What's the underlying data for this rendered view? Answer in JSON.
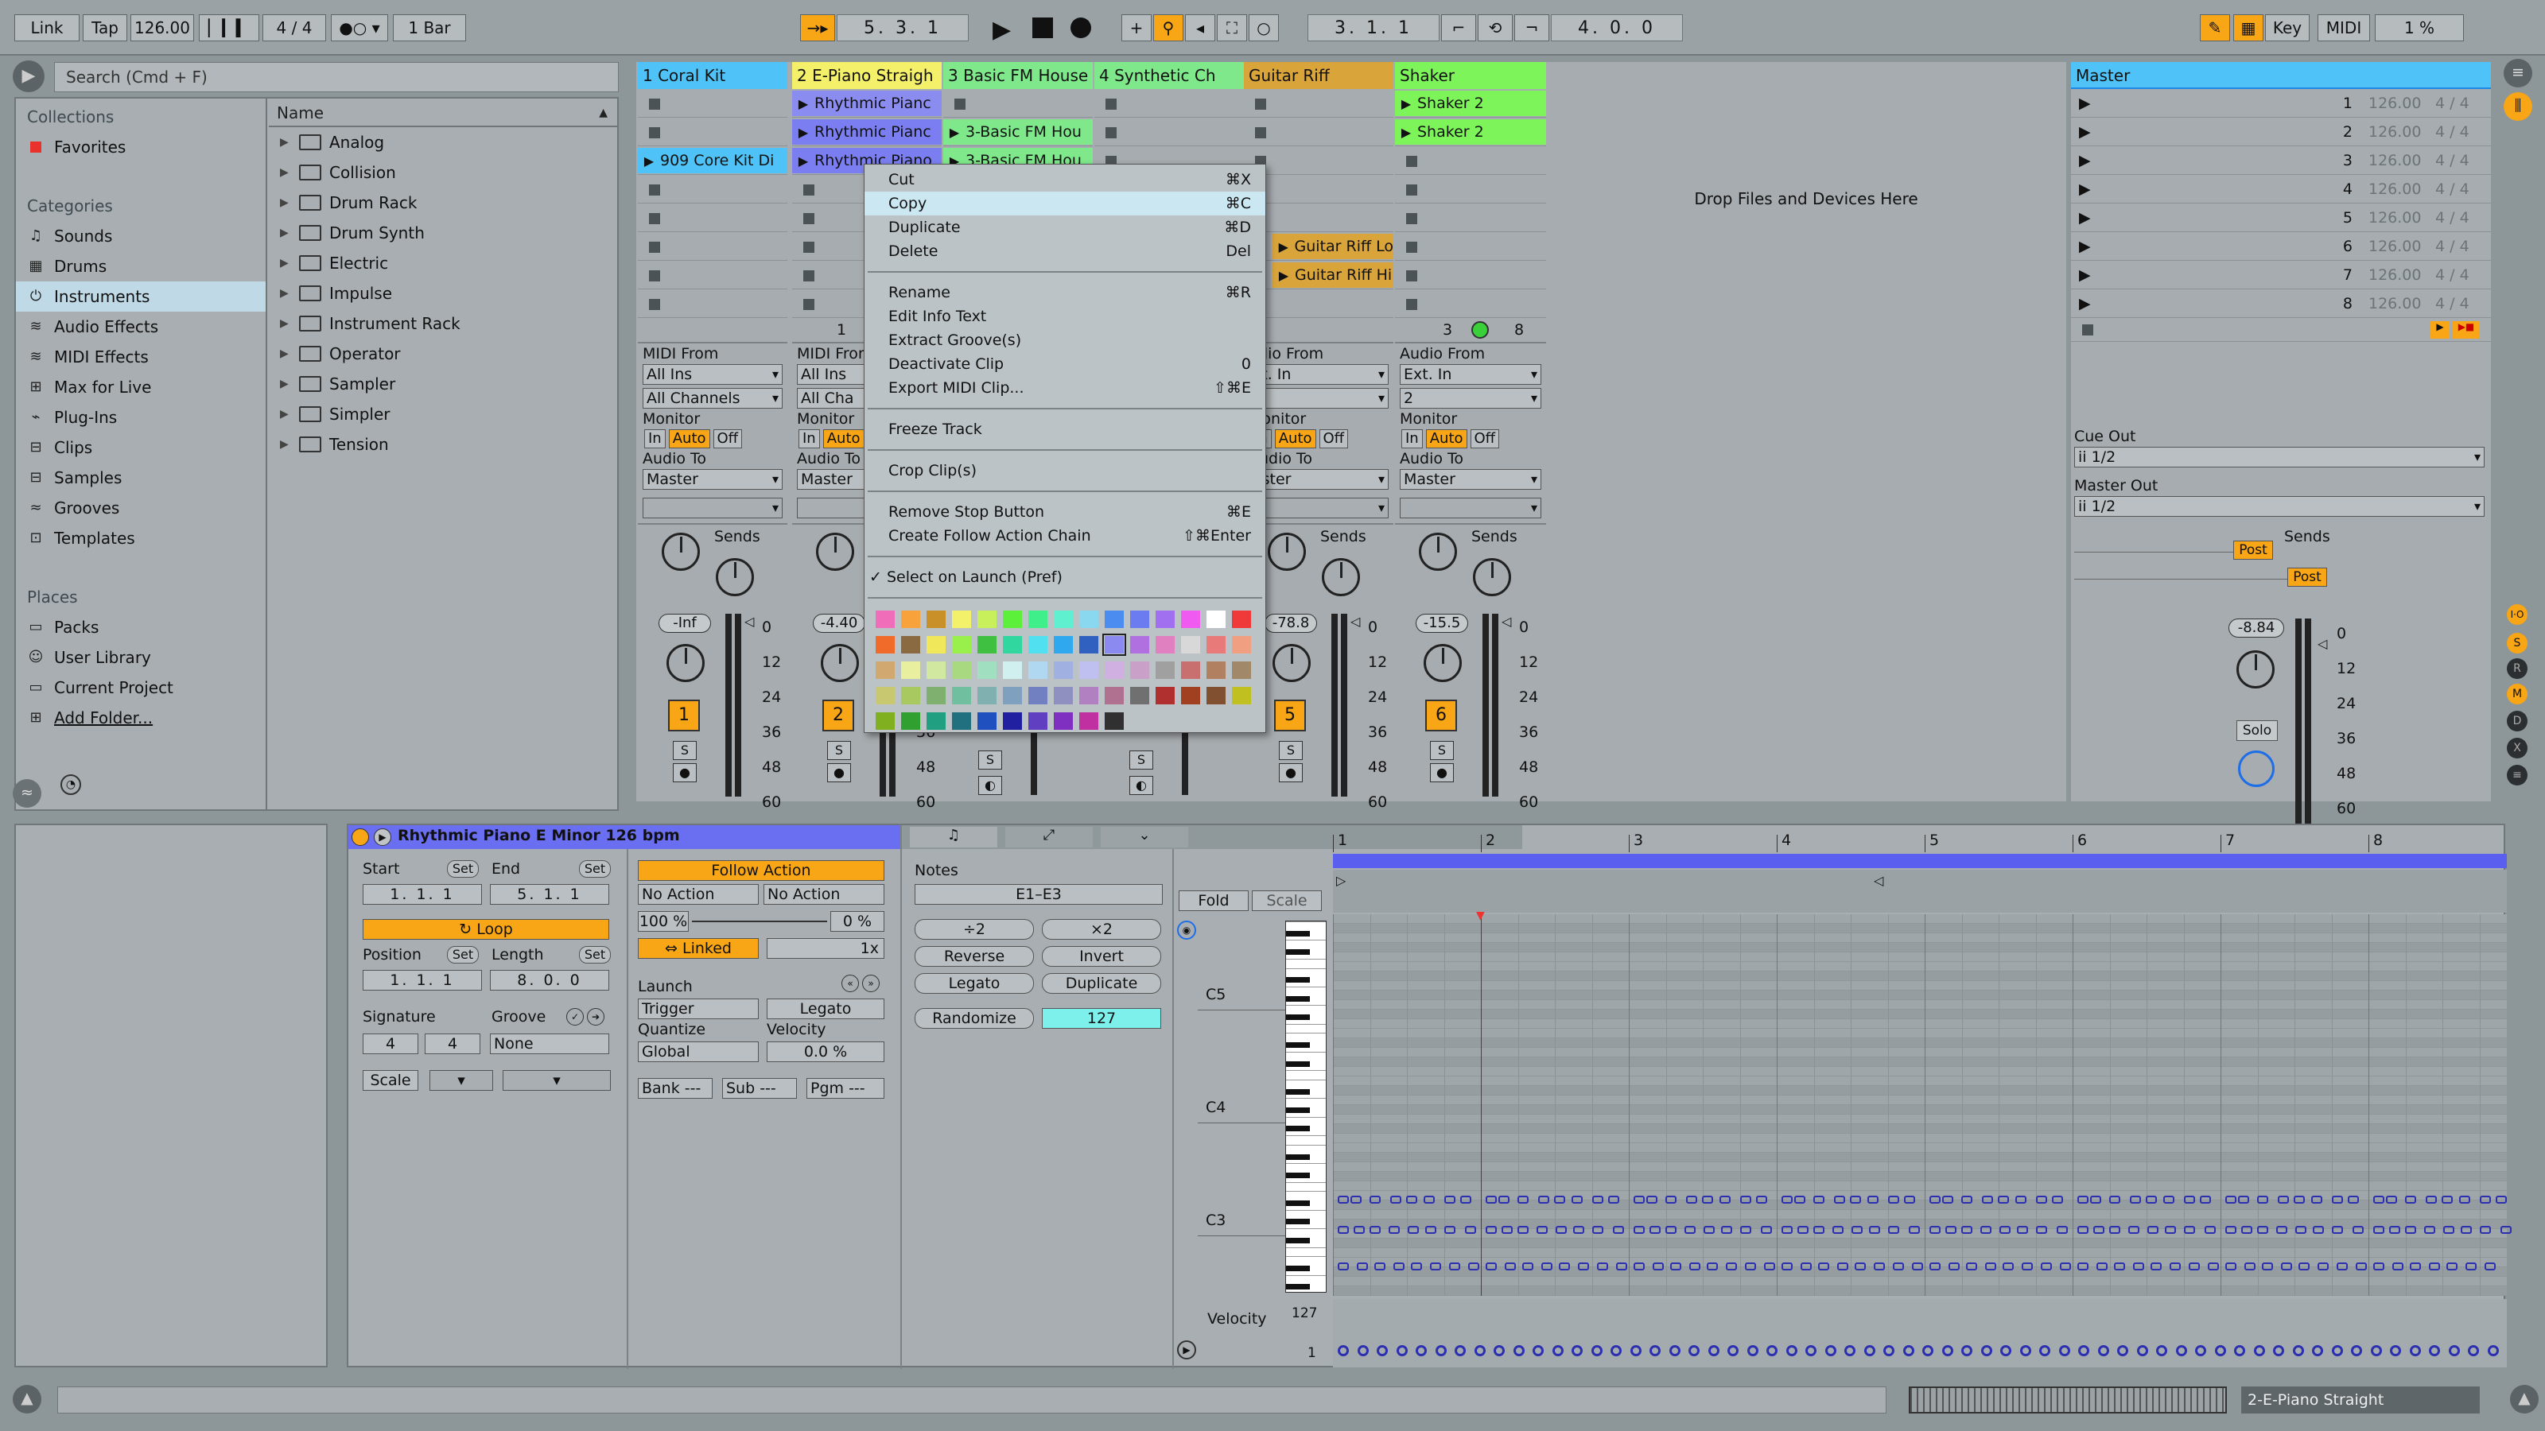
{
  "transport": {
    "link": "Link",
    "tap": "Tap",
    "tempo": "126.00",
    "signature": "4 / 4",
    "quantize": "1 Bar",
    "position": "5. 3. 1",
    "loop_start": "3. 1. 1",
    "loop_length": "4. 0. 0",
    "key": "Key",
    "midi": "MIDI",
    "cpu": "1 %"
  },
  "browser": {
    "search_placeholder": "Search (Cmd + F)",
    "collections_label": "Collections",
    "favorites": "Favorites",
    "categories_label": "Categories",
    "categories": [
      "Sounds",
      "Drums",
      "Instruments",
      "Audio Effects",
      "MIDI Effects",
      "Max for Live",
      "Plug-Ins",
      "Clips",
      "Samples",
      "Grooves",
      "Templates"
    ],
    "places_label": "Places",
    "places": [
      "Packs",
      "User Library",
      "Current Project",
      "Add Folder..."
    ],
    "name_header": "Name",
    "items": [
      "Analog",
      "Collision",
      "Drum Rack",
      "Drum Synth",
      "Electric",
      "Impulse",
      "Instrument Rack",
      "Operator",
      "Sampler",
      "Simpler",
      "Tension"
    ]
  },
  "tracks": [
    {
      "name": "1 Coral Kit",
      "color": "#4fc3f7",
      "clips": [
        "",
        "",
        "909 Core Kit Di"
      ],
      "io_from": "MIDI From",
      "in1": "All Ins",
      "in2": "All Channels",
      "to": "Master",
      "vol": "-Inf",
      "num": "1"
    },
    {
      "name": "2 E-Piano Straigh",
      "color": "#f4f06a",
      "clips": [
        "Rhythmic Pianc",
        "Rhythmic Pianc",
        "Rhythmic Piano"
      ],
      "io_from": "MIDI From",
      "in1": "All Ins",
      "in2": "All Cha",
      "to": "Master",
      "vol": "-4.40",
      "num": "2"
    },
    {
      "name": "3 Basic FM House",
      "color": "#7ee88a",
      "clips": [
        "",
        "3-Basic FM Hou",
        "3-Basic FM Hou"
      ],
      "io_from": "",
      "in1": "",
      "in2": "",
      "to": "",
      "vol": "",
      "num": ""
    },
    {
      "name": "4 Synthetic Ch",
      "color": "#7ee88a",
      "clips": [
        "",
        "",
        ""
      ],
      "io_from": "",
      "in1": "",
      "in2": "",
      "to": "",
      "vol": "",
      "num": ""
    },
    {
      "name": "Guitar Riff",
      "color": "#d9a43a",
      "clips": [
        "",
        "",
        "",
        "",
        "",
        "Guitar Riff Lo",
        "Guitar Riff Hi"
      ],
      "io_from": "udio From",
      "in1": "xt. In",
      "in2": "1",
      "to": "aster",
      "vol": "-78.8",
      "num": "5"
    },
    {
      "name": "Shaker",
      "color": "#7df55a",
      "clips": [
        "Shaker 2",
        "Shaker 2"
      ],
      "io_from": "Audio From",
      "in1": "Ext. In",
      "in2": "2",
      "to": "Master",
      "vol": "-15.5",
      "num": "6"
    }
  ],
  "session": {
    "drop_hint": "Drop Files and Devices Here",
    "sends": "Sends",
    "monitor": "Monitor",
    "audio_to": "Audio To",
    "in": "In",
    "auto": "Auto",
    "off": "Off",
    "s": "S",
    "track_num_3": "3",
    "track_num_8": "8",
    "track2_one": "1"
  },
  "master": {
    "name": "Master",
    "scenes": [
      {
        "n": "1",
        "bpm": "126.00",
        "sig": "4 / 4"
      },
      {
        "n": "2",
        "bpm": "126.00",
        "sig": "4 / 4"
      },
      {
        "n": "3",
        "bpm": "126.00",
        "sig": "4 / 4"
      },
      {
        "n": "4",
        "bpm": "126.00",
        "sig": "4 / 4"
      },
      {
        "n": "5",
        "bpm": "126.00",
        "sig": "4 / 4"
      },
      {
        "n": "6",
        "bpm": "126.00",
        "sig": "4 / 4"
      },
      {
        "n": "7",
        "bpm": "126.00",
        "sig": "4 / 4"
      },
      {
        "n": "8",
        "bpm": "126.00",
        "sig": "4 / 4"
      }
    ],
    "cue_out": "Cue Out",
    "cue_val": "ii 1/2",
    "master_out": "Master Out",
    "master_val": "ii 1/2",
    "post": "Post",
    "vol": "-8.84",
    "solo": "Solo"
  },
  "meter_scale": [
    "0",
    "12",
    "24",
    "36",
    "48",
    "60"
  ],
  "context_menu": {
    "groups": [
      [
        {
          "label": "Cut",
          "key": "⌘X"
        },
        {
          "label": "Copy",
          "key": "⌘C"
        },
        {
          "label": "Duplicate",
          "key": "⌘D"
        },
        {
          "label": "Delete",
          "key": "Del"
        }
      ],
      [
        {
          "label": "Rename",
          "key": "⌘R"
        },
        {
          "label": "Edit Info Text",
          "key": ""
        },
        {
          "label": "Extract Groove(s)",
          "key": ""
        },
        {
          "label": "Deactivate Clip",
          "key": "0"
        },
        {
          "label": "Export MIDI Clip...",
          "key": "⇧⌘E"
        }
      ],
      [
        {
          "label": "Freeze Track",
          "key": ""
        }
      ],
      [
        {
          "label": "Crop Clip(s)",
          "key": ""
        }
      ],
      [
        {
          "label": "Remove Stop Button",
          "key": "⌘E"
        },
        {
          "label": "Create Follow Action Chain",
          "key": "⇧⌘Enter"
        }
      ],
      [
        {
          "label": "✓ Select on Launch (Pref)",
          "key": ""
        }
      ]
    ],
    "swatches": [
      "#f06dba",
      "#f7a23a",
      "#c9902a",
      "#f3f06a",
      "#c8f05a",
      "#5cf03a",
      "#3ff08a",
      "#5ff0d0",
      "#8ad8f0",
      "#4a8cf0",
      "#6a7cf0",
      "#a070f0",
      "#f05af0",
      "#ffffff",
      "#f03a3a",
      "#f06a2a",
      "#8a6a40",
      "#f0e85a",
      "#9af04a",
      "#40c040",
      "#30d8a0",
      "#50e0f0",
      "#30a8f0",
      "#3060c0",
      "#8a8af0",
      "#b070e0",
      "#e080c0",
      "#d8d8d8",
      "#e87a7a",
      "#f0a080",
      "#d0a870",
      "#e8f0a0",
      "#d0e8a0",
      "#a8d880",
      "#a0e0c0",
      "#d0f0f0",
      "#b0d8f0",
      "#a0b0e0",
      "#c0c0f0",
      "#d0b0e0",
      "#c8a0c8",
      "#a0a0a0",
      "#c87070",
      "#b08060",
      "#a08868",
      "#c8c870",
      "#a8c860",
      "#80b070",
      "#70c0a0",
      "#80b0b0",
      "#80a0c0",
      "#7080c0",
      "#9090c0",
      "#b080c0",
      "#b07090",
      "#707070",
      "#b03030",
      "#a04020",
      "#805030",
      "#c0c020",
      "#80b020",
      "#30a030",
      "#20a080",
      "#207080",
      "#2050c0",
      "#2020a0",
      "#6040c0",
      "#8030c0",
      "#c030a0",
      "#303030"
    ]
  },
  "clip_detail": {
    "title": "Rhythmic Piano E Minor 126 bpm",
    "start": "Start",
    "end": "End",
    "set": "Set",
    "start_val": "1. 1. 1",
    "end_val": "5. 1. 1",
    "loop": "Loop",
    "position": "Position",
    "length": "Length",
    "pos_val": "1. 1. 1",
    "len_val": "8. 0. 0",
    "signature": "Signature",
    "groove": "Groove",
    "sig_num": "4",
    "sig_den": "4",
    "groove_val": "None",
    "scale": "Scale",
    "follow_action": "Follow Action",
    "no_action_a": "No Action",
    "no_action_b": "No Action",
    "chance_a": "100 %",
    "chance_b": "0 %",
    "linked": "Linked",
    "times": "1x",
    "launch": "Launch",
    "trigger": "Trigger",
    "legato": "Legato",
    "quantize": "Quantize",
    "velocity": "Velocity",
    "quant_val": "Global",
    "vel_val": "0.0 %",
    "bank": "Bank ---",
    "sub": "Sub ---",
    "pgm": "Pgm ---"
  },
  "notes_panel": {
    "notes": "Notes",
    "range": "E1–E3",
    "half": "÷2",
    "double": "×2",
    "reverse": "Reverse",
    "invert": "Invert",
    "legato": "Legato",
    "duplicate": "Duplicate",
    "randomize": "Randomize",
    "rand_val": "127",
    "fold": "Fold",
    "scale": "Scale"
  },
  "piano_roll": {
    "bars": [
      "1",
      "2",
      "3",
      "4",
      "5",
      "6",
      "7",
      "8"
    ],
    "keys": [
      "C5",
      "C4",
      "C3"
    ],
    "velocity": "Velocity",
    "vmax": "127",
    "vmin": "1"
  },
  "status": {
    "track": "2-E-Piano Straight"
  }
}
